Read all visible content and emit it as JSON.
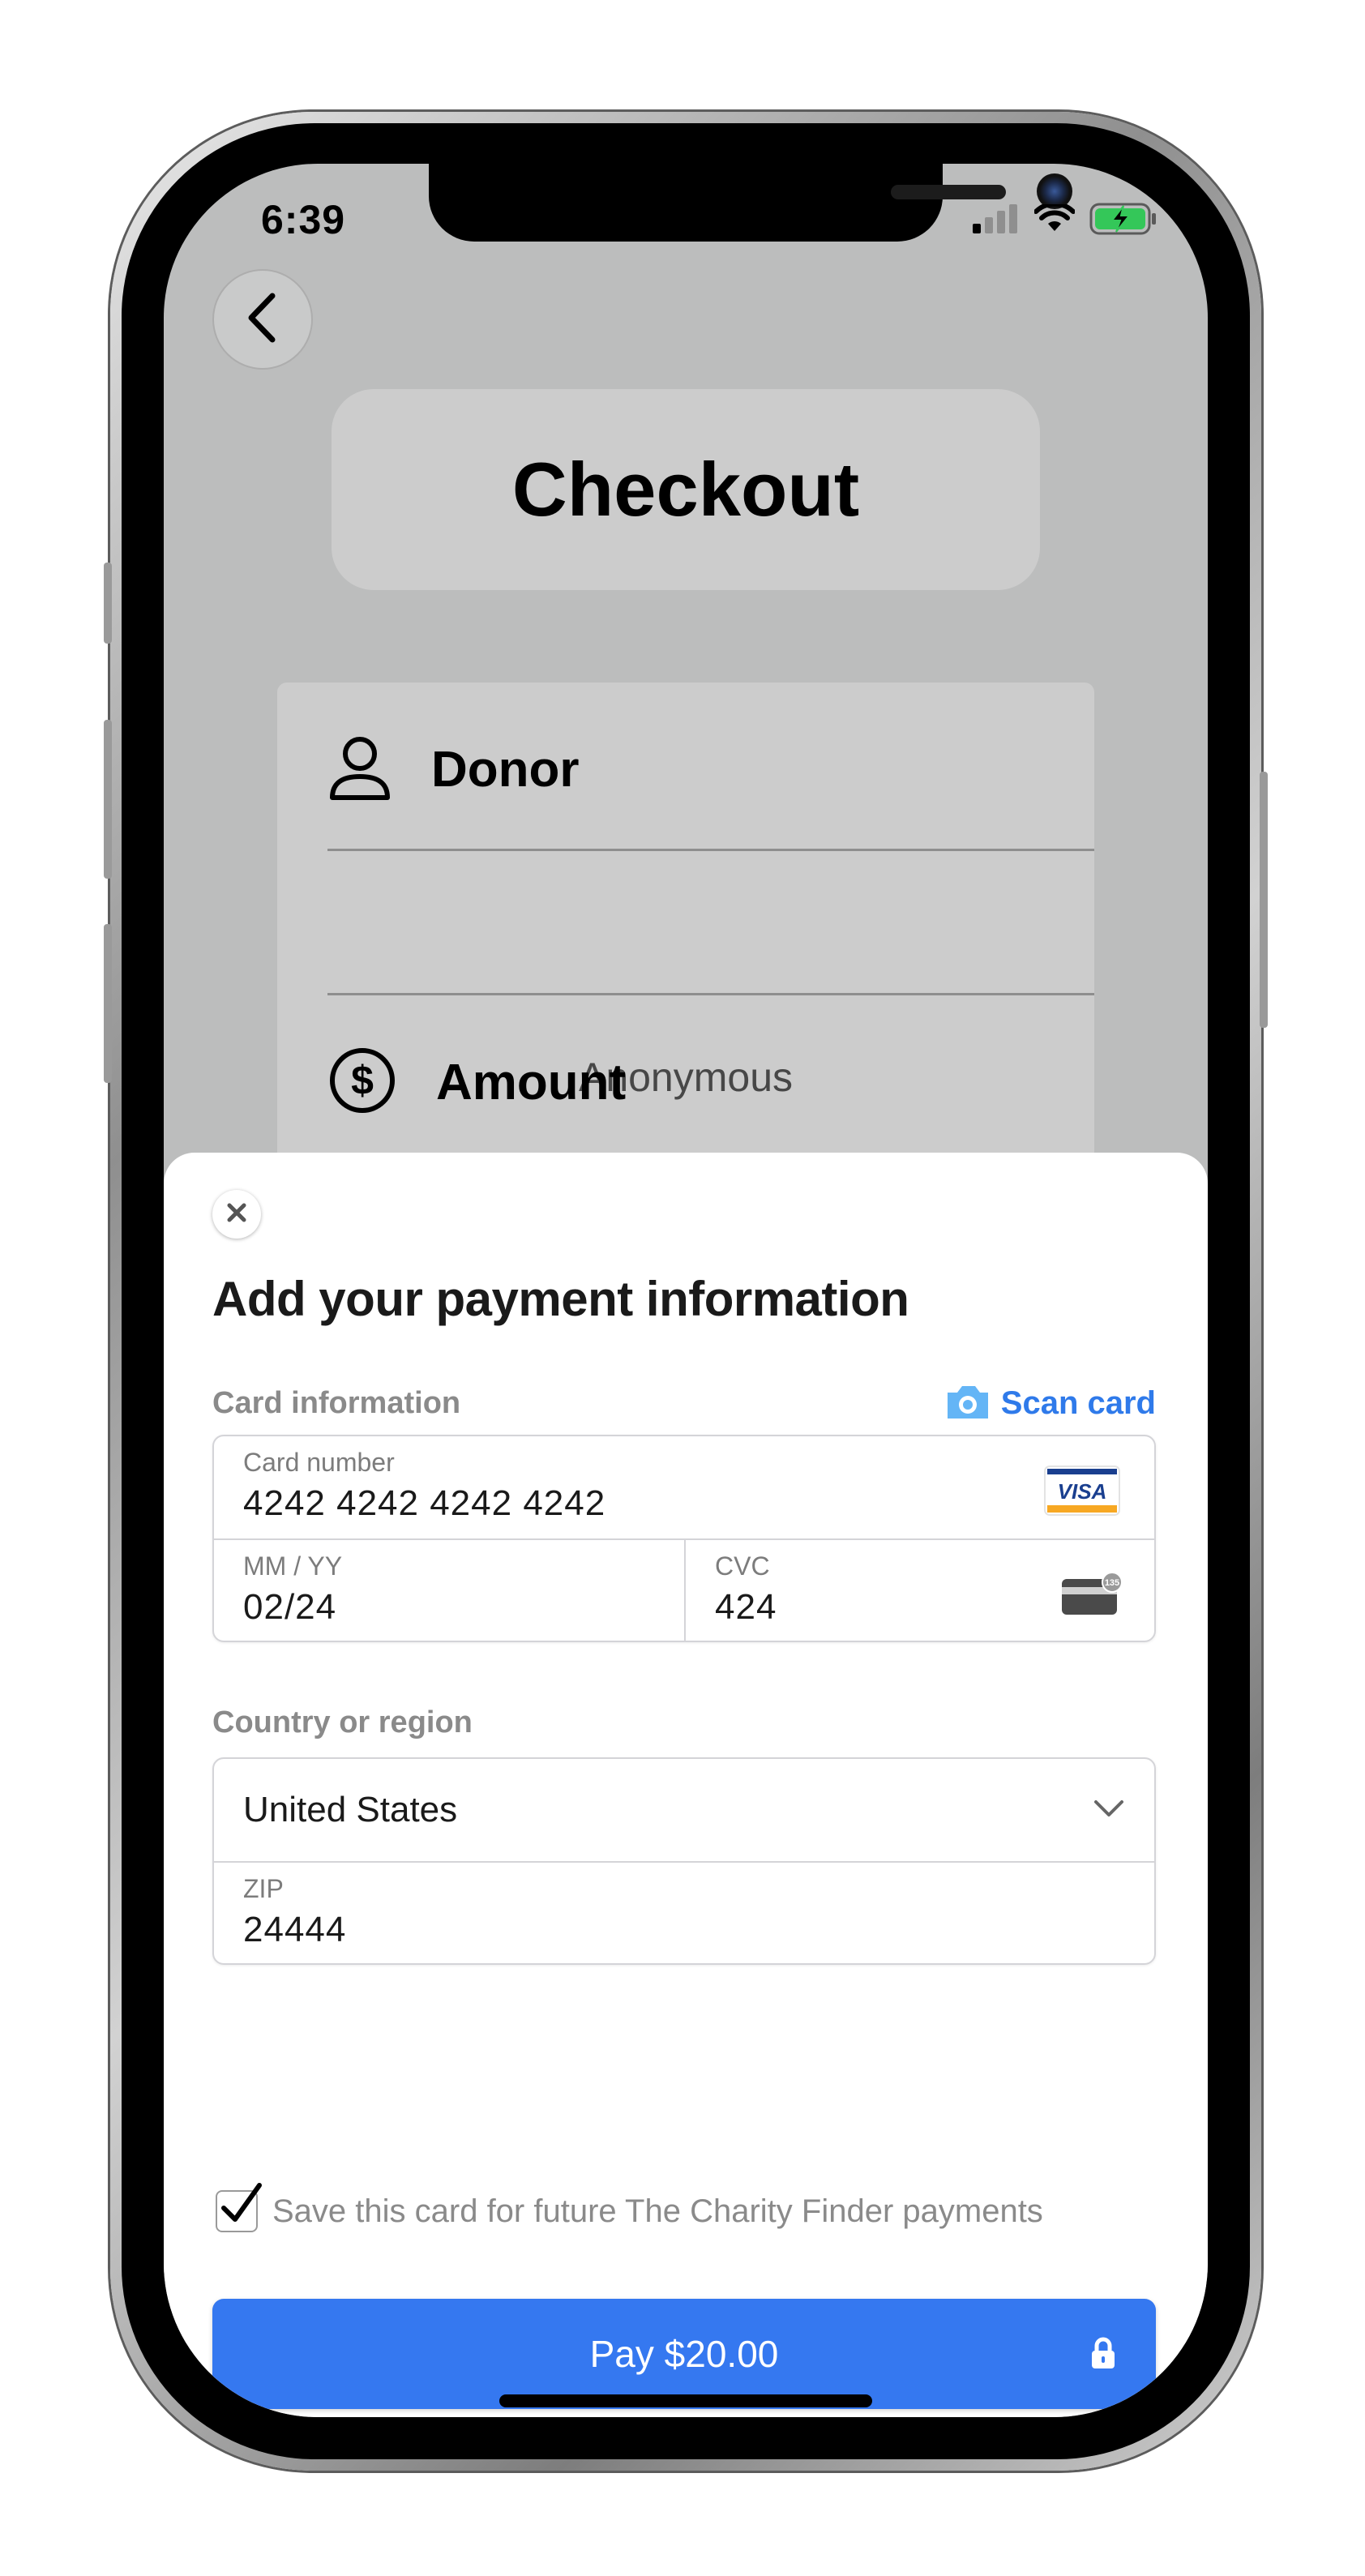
{
  "status_bar": {
    "time": "6:39",
    "icons": [
      "cellular-signal-icon",
      "wifi-icon",
      "battery-charging-icon"
    ]
  },
  "header": {
    "back_icon": "chevron-left-icon",
    "title": "Checkout"
  },
  "form": {
    "donor": {
      "icon": "person-icon",
      "label": "Donor",
      "value": "Anonymous"
    },
    "amount": {
      "icon": "dollar-circle-icon",
      "label": "Amount"
    }
  },
  "payment_sheet": {
    "close_icon": "close-icon",
    "title": "Add your payment information",
    "card_section_label": "Card information",
    "scan_card": {
      "icon": "camera-icon",
      "label": "Scan card"
    },
    "card_number": {
      "label": "Card number",
      "value": "4242 4242 4242 4242",
      "brand": "VISA"
    },
    "expiry": {
      "label": "MM / YY",
      "value": "02/24"
    },
    "cvc": {
      "label": "CVC",
      "value": "424",
      "icon_text": "135"
    },
    "country_section_label": "Country or region",
    "country": {
      "value": "United States",
      "icon": "chevron-down-icon"
    },
    "zip": {
      "label": "ZIP",
      "value": "24444"
    },
    "save_card": {
      "checked": true,
      "label": "Save this card for future The Charity Finder payments"
    },
    "pay_button": {
      "label": "Pay $20.00",
      "icon": "lock-icon"
    }
  },
  "colors": {
    "accent": "#3578f0",
    "link": "#2f7aea",
    "backdrop": "#bcbdbd",
    "card": "#cccccc"
  }
}
